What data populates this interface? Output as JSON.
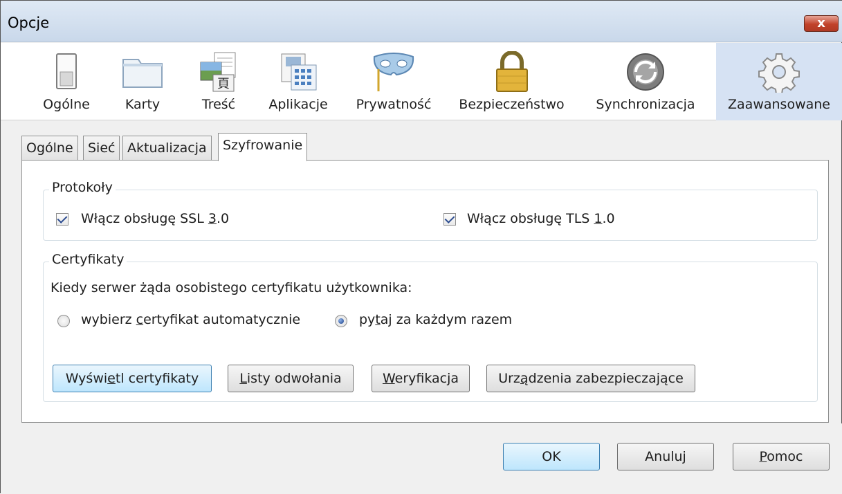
{
  "window": {
    "title": "Opcje",
    "close_glyph": "x"
  },
  "toolbar": {
    "items": [
      {
        "label": "Ogólne",
        "icon": "switch-icon"
      },
      {
        "label": "Karty",
        "icon": "tabs-icon"
      },
      {
        "label": "Treść",
        "icon": "content-icon"
      },
      {
        "label": "Aplikacje",
        "icon": "applications-icon"
      },
      {
        "label": "Prywatność",
        "icon": "mask-icon"
      },
      {
        "label": "Bezpieczeństwo",
        "icon": "lock-icon"
      },
      {
        "label": "Synchronizacja",
        "icon": "sync-icon"
      },
      {
        "label": "Zaawansowane",
        "icon": "gear-icon",
        "active": true
      }
    ]
  },
  "tabs": [
    {
      "label": "Ogólne"
    },
    {
      "label": "Sieć"
    },
    {
      "label": "Aktualizacja"
    },
    {
      "label": "Szyfrowanie",
      "active": true
    }
  ],
  "protocols": {
    "title": "Protokoły",
    "ssl": {
      "pre": "Włącz obsługę SSL ",
      "key": "3",
      "post": ".0",
      "checked": true
    },
    "tls": {
      "pre": "Włącz obsługę TLS ",
      "key": "1",
      "post": ".0",
      "checked": true
    }
  },
  "certificates": {
    "title": "Certyfikaty",
    "prompt": "Kiedy serwer żąda osobistego certyfikatu użytkownika:",
    "auto": {
      "pre": "wybierz ",
      "key": "c",
      "post": "ertyfikat automatycznie",
      "selected": false
    },
    "ask": {
      "pre": "py",
      "key": "t",
      "post": "aj za każdym razem",
      "selected": true
    },
    "buttons": {
      "view": {
        "pre": "Wyświ",
        "key": "e",
        "post": "tl certyfikaty"
      },
      "revocation": {
        "pre": "",
        "key": "L",
        "post": "isty odwołania"
      },
      "validation": {
        "pre": "",
        "key": "W",
        "post": "eryfikacja"
      },
      "devices": {
        "pre": "Urz",
        "key": "ą",
        "post": "dzenia zabezpieczające"
      }
    }
  },
  "footer": {
    "ok": "OK",
    "cancel": "Anuluj",
    "help": {
      "pre": "",
      "key": "P",
      "post": "omoc"
    }
  },
  "colors": {
    "accent_active": "#d6e2f3",
    "primary_button": "#bee6fd",
    "close_button": "#c1422a"
  }
}
